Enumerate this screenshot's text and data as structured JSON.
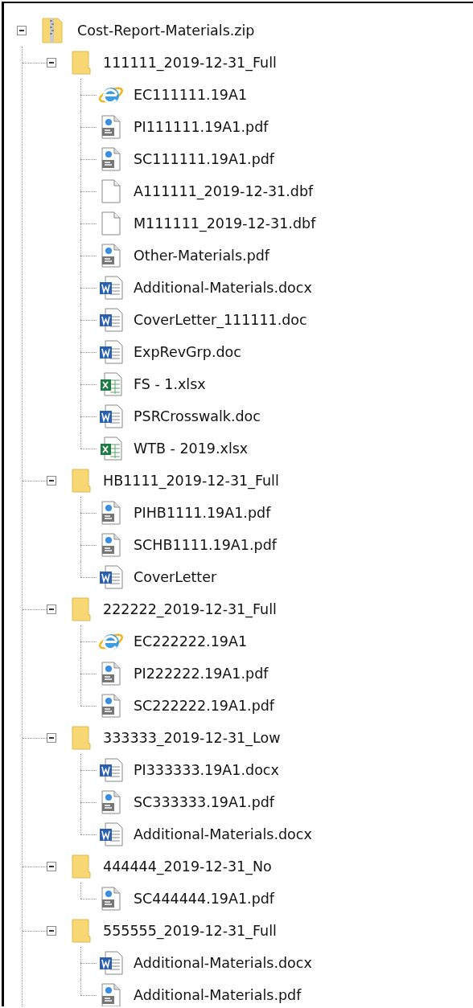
{
  "tree": {
    "name": "Cost-Report-Materials.zip",
    "kind": "zip",
    "expanded": true,
    "children": [
      {
        "name": "111111_2019-12-31_Full",
        "kind": "folder",
        "expanded": true,
        "children": [
          {
            "name": "EC111111.19A1",
            "kind": "web"
          },
          {
            "name": "PI111111.19A1.pdf",
            "kind": "pdf"
          },
          {
            "name": "SC111111.19A1.pdf",
            "kind": "pdf"
          },
          {
            "name": "A111111_2019-12-31.dbf",
            "kind": "blank"
          },
          {
            "name": "M111111_2019-12-31.dbf",
            "kind": "blank"
          },
          {
            "name": "Other-Materials.pdf",
            "kind": "pdf"
          },
          {
            "name": "Additional-Materials.docx",
            "kind": "word"
          },
          {
            "name": "CoverLetter_111111.doc",
            "kind": "word"
          },
          {
            "name": "ExpRevGrp.doc",
            "kind": "word"
          },
          {
            "name": "FS - 1.xlsx",
            "kind": "excel"
          },
          {
            "name": "PSRCrosswalk.doc",
            "kind": "word"
          },
          {
            "name": "WTB - 2019.xlsx",
            "kind": "excel"
          }
        ]
      },
      {
        "name": "HB1111_2019-12-31_Full",
        "kind": "folder",
        "expanded": true,
        "children": [
          {
            "name": "PIHB1111.19A1.pdf",
            "kind": "pdf"
          },
          {
            "name": "SCHB1111.19A1.pdf",
            "kind": "pdf"
          },
          {
            "name": "CoverLetter",
            "kind": "word"
          }
        ]
      },
      {
        "name": "222222_2019-12-31_Full",
        "kind": "folder",
        "expanded": true,
        "children": [
          {
            "name": "EC222222.19A1",
            "kind": "web"
          },
          {
            "name": "PI222222.19A1.pdf",
            "kind": "pdf"
          },
          {
            "name": "SC222222.19A1.pdf",
            "kind": "pdf"
          }
        ]
      },
      {
        "name": "333333_2019-12-31_Low",
        "kind": "folder",
        "expanded": true,
        "children": [
          {
            "name": "PI333333.19A1.docx",
            "kind": "word"
          },
          {
            "name": "SC333333.19A1.pdf",
            "kind": "pdf"
          },
          {
            "name": "Additional-Materials.docx",
            "kind": "word"
          }
        ]
      },
      {
        "name": "444444_2019-12-31_No",
        "kind": "folder",
        "expanded": true,
        "children": [
          {
            "name": "SC444444.19A1.pdf",
            "kind": "pdf"
          }
        ]
      },
      {
        "name": "555555_2019-12-31_Full",
        "kind": "folder",
        "expanded": true,
        "children": [
          {
            "name": "Additional-Materials.docx",
            "kind": "word"
          },
          {
            "name": "Additional-Materials.pdf",
            "kind": "pdf"
          }
        ]
      }
    ]
  }
}
